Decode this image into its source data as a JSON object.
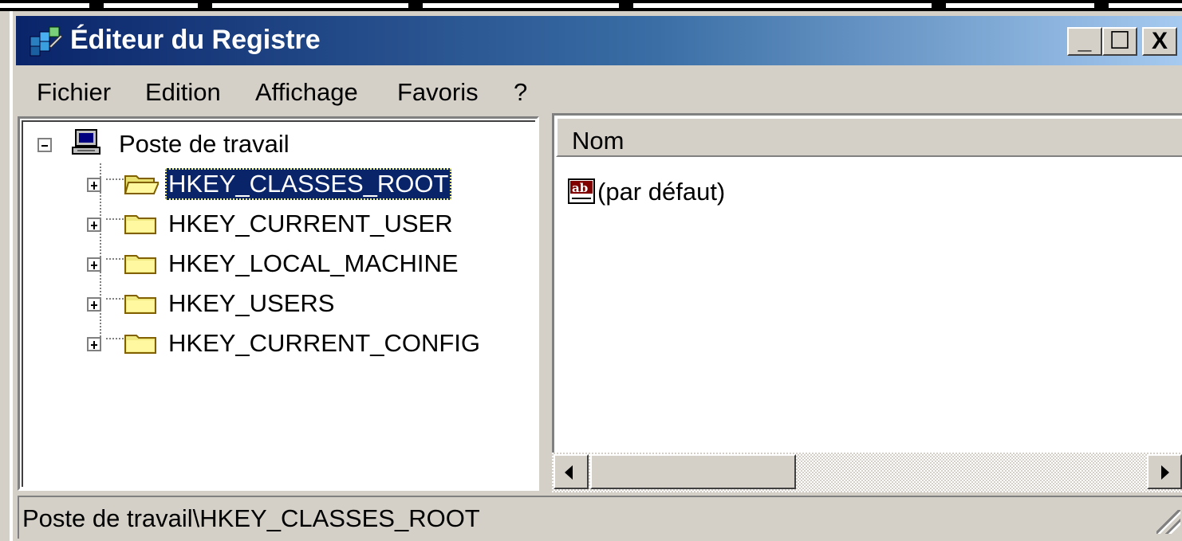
{
  "window": {
    "title": "Éditeur du Registre",
    "minimize_glyph": "_",
    "maximize_glyph": "☐",
    "close_glyph": "X",
    "icon": "regedit-icon"
  },
  "menu": {
    "items": [
      "Fichier",
      "Edition",
      "Affichage",
      "Favoris",
      "?"
    ]
  },
  "tree": {
    "root": {
      "label": "Poste de travail",
      "icon": "computer-icon",
      "expanded": true
    },
    "keys": [
      {
        "label": "HKEY_CLASSES_ROOT",
        "selected": true,
        "icon": "open-folder-icon"
      },
      {
        "label": "HKEY_CURRENT_USER",
        "selected": false,
        "icon": "folder-icon"
      },
      {
        "label": "HKEY_LOCAL_MACHINE",
        "selected": false,
        "icon": "folder-icon"
      },
      {
        "label": "HKEY_USERS",
        "selected": false,
        "icon": "folder-icon"
      },
      {
        "label": "HKEY_CURRENT_CONFIG",
        "selected": false,
        "icon": "folder-icon"
      }
    ]
  },
  "list": {
    "columns": [
      "Nom"
    ],
    "rows": [
      {
        "name": "(par défaut)",
        "icon": "string-value-icon"
      }
    ]
  },
  "status": {
    "path": "Poste de travail\\HKEY_CLASSES_ROOT"
  },
  "colors": {
    "titlebar_start": "#0a246a",
    "titlebar_end": "#a6caf0",
    "selection": "#0a246a",
    "face": "#d4d0c8"
  }
}
